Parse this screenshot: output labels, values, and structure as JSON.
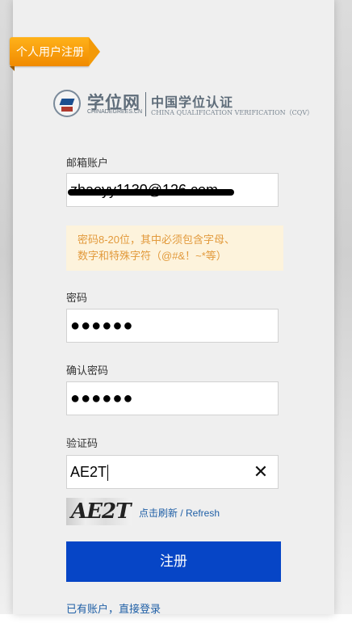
{
  "ribbon": {
    "label": "个人用户注册"
  },
  "logo": {
    "cn": "学位网",
    "en": "CHINADEGREES.CN",
    "cn2": "中国学位认证",
    "en2": "CHINA QUALIFICATION VERIFICATION（CQV）"
  },
  "form": {
    "email_label": "邮箱账户",
    "email_value": "zhaoyy1130@126.com",
    "password_hint_line1": "密码8-20位，其中必须包含字母、",
    "password_hint_line2": "数字和特殊字符（@#&！~*等）",
    "password_label": "密码",
    "password_value": "●●●●●●",
    "confirm_label": "确认密码",
    "confirm_value": "●●●●●●",
    "captcha_label": "验证码",
    "captcha_value": "AE2T",
    "captcha_image_text": "AE2T",
    "refresh_label": "点击刷新 / Refresh",
    "submit_label": "注册",
    "login_link": "已有账户，直接登录"
  },
  "icons": {
    "clear": "close-icon"
  },
  "colors": {
    "accent": "#0645c6",
    "ribbon": "#f39a08",
    "hint_bg": "#fdf3dc",
    "hint_text": "#e29a3c",
    "link": "#1f5fa6"
  }
}
